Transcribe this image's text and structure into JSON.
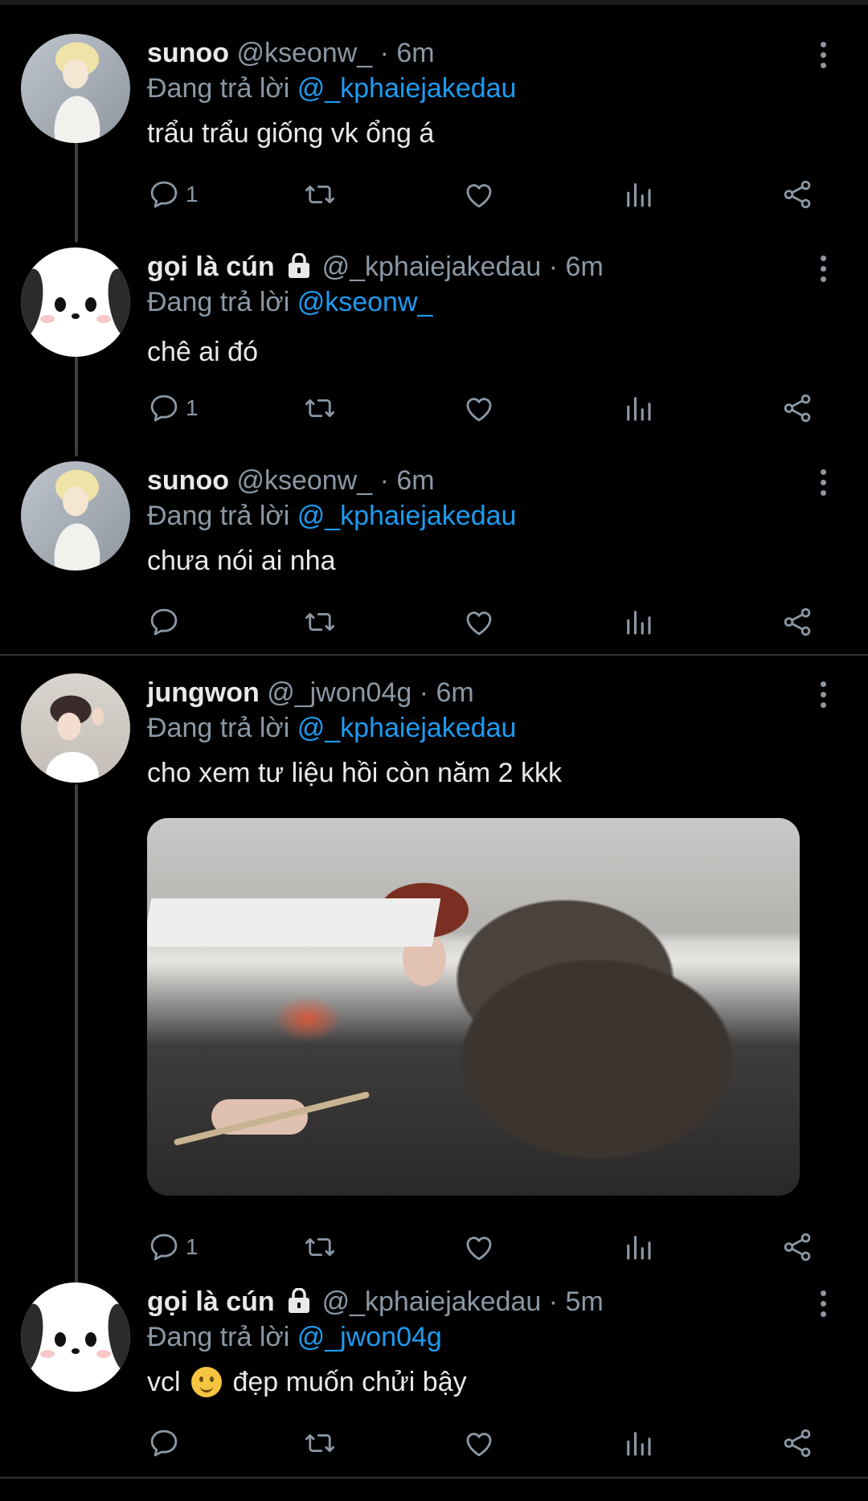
{
  "icons": {
    "reply": "reply-icon",
    "retweet": "retweet-icon",
    "like": "heart-icon",
    "stats": "stats-icon",
    "share": "share-icon",
    "more": "more-vertical-icon",
    "lock": "lock-icon"
  },
  "colors": {
    "background": "#000000",
    "mention": "#1d9bf0",
    "muted": "#8b98a5",
    "text": "#e7e9ea"
  },
  "tweets": [
    {
      "name": "sunoo",
      "handle": "@kseonw_",
      "time": "6m",
      "replying_prefix": "Đang trả lời",
      "replying_to": "@_kphaiejakedau",
      "text": "trẩu trẩu giống vk ổng á",
      "reply_count": "1"
    },
    {
      "name": "gọi là cún",
      "handle": "@_kphaiejakedau",
      "time": "6m",
      "replying_prefix": "Đang trả lời",
      "replying_to": "@kseonw_",
      "text": "chê ai đó",
      "reply_count": "1"
    },
    {
      "name": "sunoo",
      "handle": "@kseonw_",
      "time": "6m",
      "replying_prefix": "Đang trả lời",
      "replying_to": "@_kphaiejakedau",
      "text": "chưa nói ai nha",
      "reply_count": ""
    },
    {
      "name": "jungwon",
      "handle": "@_jwon04g",
      "time": "6m",
      "replying_prefix": "Đang trả lời",
      "replying_to": "@_kphaiejakedau",
      "text": "cho xem tư liệu hồi còn năm 2 kkk",
      "reply_count": "1"
    },
    {
      "name": "gọi là cún",
      "handle": "@_kphaiejakedau",
      "time": "5m",
      "replying_prefix": "Đang trả lời",
      "replying_to": "@_jwon04g",
      "text_before": "vcl",
      "text_after": "đẹp muốn chửi bậy",
      "reply_count": ""
    }
  ]
}
